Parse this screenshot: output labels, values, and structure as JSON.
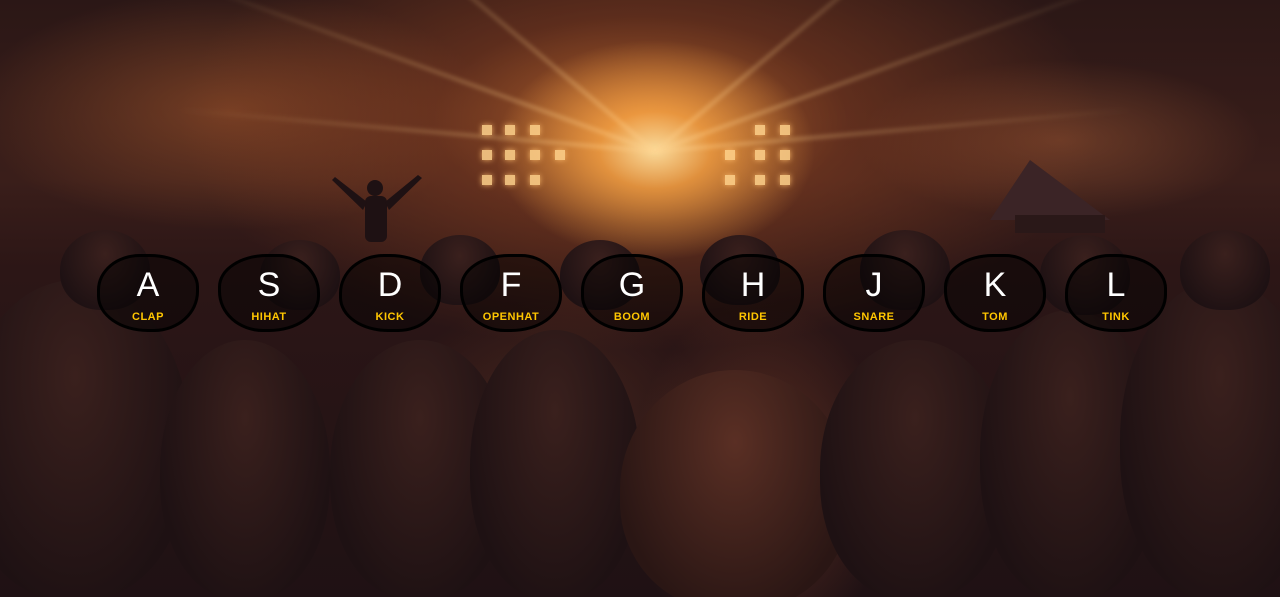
{
  "keys": [
    {
      "key": "A",
      "sound": "CLAP"
    },
    {
      "key": "S",
      "sound": "HIHAT"
    },
    {
      "key": "D",
      "sound": "KICK"
    },
    {
      "key": "F",
      "sound": "OPENHAT"
    },
    {
      "key": "G",
      "sound": "BOOM"
    },
    {
      "key": "H",
      "sound": "RIDE"
    },
    {
      "key": "J",
      "sound": "SNARE"
    },
    {
      "key": "K",
      "sound": "TOM"
    },
    {
      "key": "L",
      "sound": "TINK"
    }
  ],
  "colors": {
    "key_letter": "#ffffff",
    "sound_label": "#ffc600",
    "key_border": "#000000"
  }
}
